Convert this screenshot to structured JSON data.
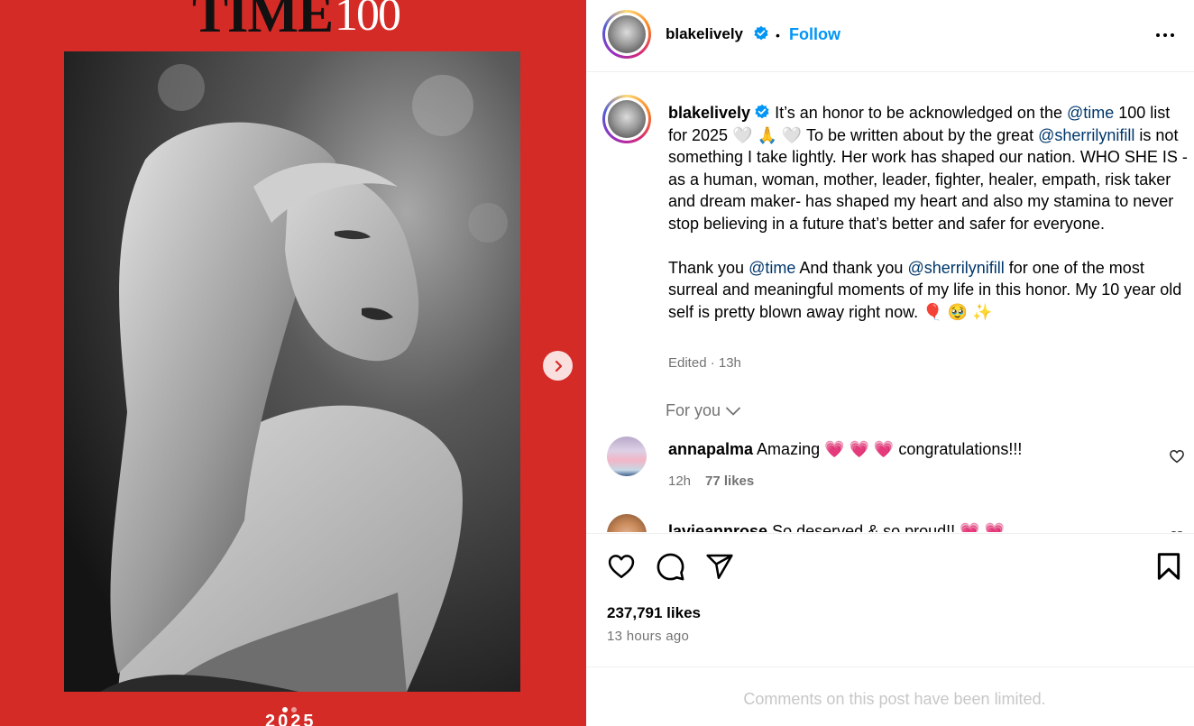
{
  "media": {
    "magazine_word": "TIME",
    "magazine_number": "100",
    "year_label": "2025",
    "carousel_total": 2,
    "carousel_active": 1,
    "background_color": "#d52b27"
  },
  "header": {
    "username": "blakelively",
    "separator": "•",
    "follow_label": "Follow",
    "more_icon": "more-options-icon"
  },
  "caption": {
    "username": "blakelively",
    "p1_a": " It’s an honor to be acknowledged on the ",
    "mention_time": "@time",
    "p1_b": " 100 list for 2025 🤍 🙏 🤍  To be written about by the great ",
    "mention_sherrilyn": "@sherrilynifill",
    "p1_c": " is not something I take lightly. Her work has shaped our nation. WHO SHE IS - as a human, woman, mother, leader, fighter, healer, empath, risk taker and dream maker- has shaped my heart and also my stamina to never stop believing in a future that’s better and safer for everyone.",
    "p2_a": "Thank you ",
    "mention_time_2": "@time",
    "p2_b": " And thank you ",
    "mention_sherrilyn_2": "@sherrilynifill",
    "p2_c": " for one of the most surreal and meaningful moments of my life in this honor. My 10 year old self is pretty blown away right now. 🎈 🥹 ✨",
    "meta": "Edited · 13h"
  },
  "sort": {
    "label": "For you"
  },
  "comments": [
    {
      "username": "annapalma",
      "text": " Amazing 💗 💗 💗  congratulations!!!",
      "time": "12h",
      "likes": "77 likes"
    },
    {
      "username": "lavieannrose",
      "text": " So deserved & so proud!! 💗 💗"
    }
  ],
  "actions": {
    "likes": "237,791 likes",
    "time_ago": "13 hours ago",
    "limited": "Comments on this post have been limited."
  },
  "colors": {
    "accent": "#0095f6",
    "mention": "#00376b",
    "muted": "#737373"
  }
}
